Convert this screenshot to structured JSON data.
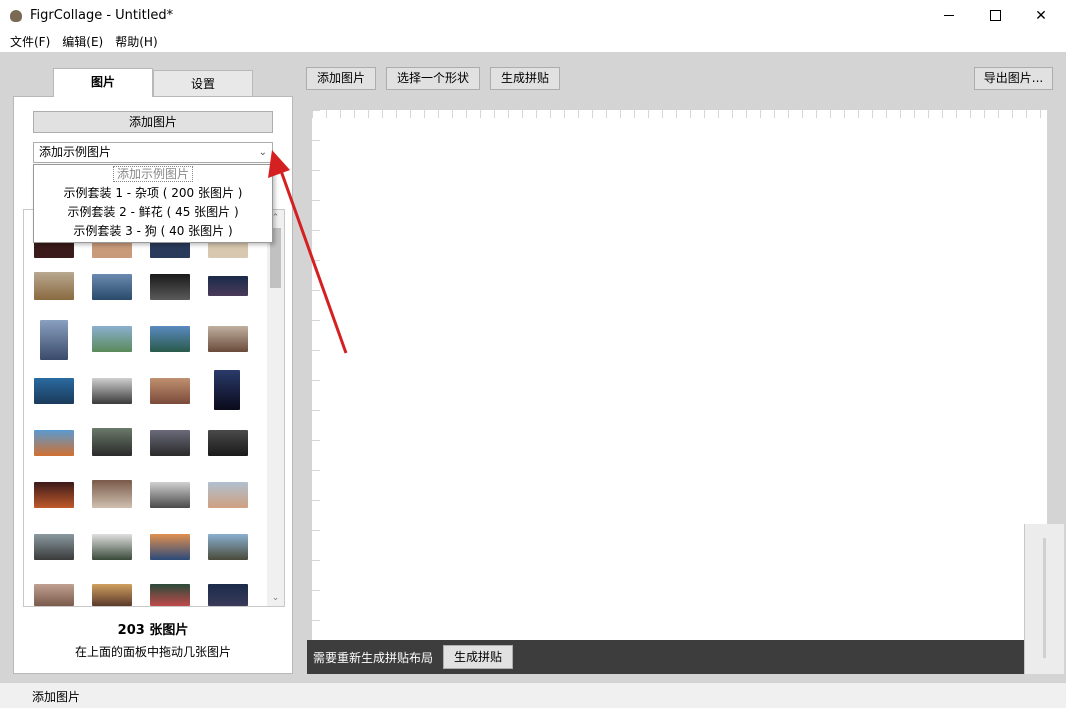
{
  "window": {
    "title": "FigrCollage - Untitled*"
  },
  "menu": [
    "文件(F)",
    "编辑(E)",
    "帮助(H)"
  ],
  "tabs": {
    "pictures": "图片",
    "settings": "设置"
  },
  "left_panel": {
    "add_button": "添加图片",
    "sample_combo": "添加示例图片",
    "dropdown": {
      "header": "添加示例图片",
      "options": [
        "示例套装 1 - 杂项 ( 200 张图片 )",
        "示例套装 2 - 鲜花 ( 45 张图片 )",
        "示例套装 3 - 狗 ( 40 张图片 )"
      ]
    },
    "count": "203 张图片",
    "hint": "在上面的面板中拖动几张图片"
  },
  "toolbar": {
    "add": "添加图片",
    "shape": "选择一个形状",
    "generate": "生成拼贴",
    "export": "导出图片..."
  },
  "notice": {
    "text": "需要重新生成拼贴布局",
    "button": "生成拼贴"
  },
  "status": "添加图片",
  "colors": {
    "accent_arrow": "#d42020",
    "notice_bg": "#3d3d3d"
  }
}
